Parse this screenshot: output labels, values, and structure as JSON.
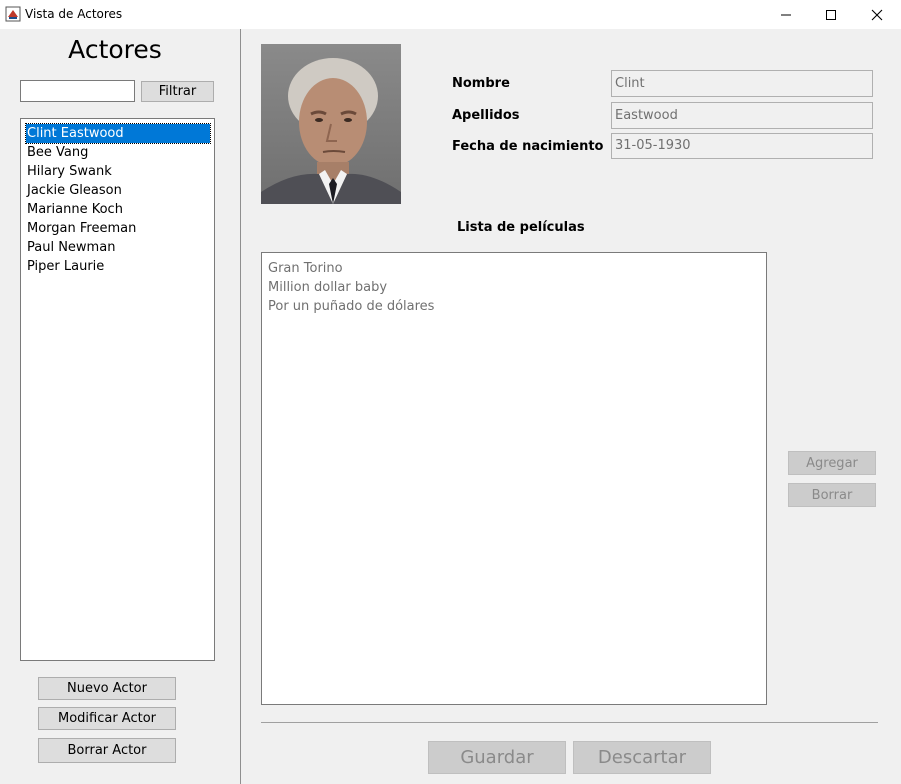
{
  "window": {
    "title": "Vista de Actores",
    "controls": [
      "minimize-icon",
      "maximize-icon",
      "close-icon"
    ]
  },
  "sidebar": {
    "heading": "Actores",
    "filter": {
      "value": "",
      "button_label": "Filtrar"
    },
    "actors": [
      "Clint Eastwood",
      "Bee Vang",
      "Hilary Swank",
      "Jackie Gleason",
      "Marianne Koch",
      "Morgan Freeman",
      "Paul Newman",
      "Piper Laurie"
    ],
    "selected_actor": "Clint Eastwood",
    "buttons": {
      "new": "Nuevo Actor",
      "modify": "Modificar Actor",
      "delete": "Borrar Actor"
    }
  },
  "details": {
    "fields": {
      "first_name": {
        "label": "Nombre",
        "value": "Clint"
      },
      "last_name": {
        "label": "Apellidos",
        "value": "Eastwood"
      },
      "birth_date": {
        "label": "Fecha de nacimiento",
        "value": "31-05-1930"
      }
    },
    "films_heading": "Lista de películas",
    "films": [
      "Gran Torino",
      "Million dollar baby",
      "Por un puñado de dólares"
    ],
    "buttons": {
      "add": "Agregar",
      "remove": "Borrar",
      "save": "Guardar",
      "discard": "Descartar"
    }
  },
  "colors": {
    "selection": "#0078d7",
    "disabled_text": "#8a8a8a",
    "panel_bg": "#f0f0f0"
  }
}
